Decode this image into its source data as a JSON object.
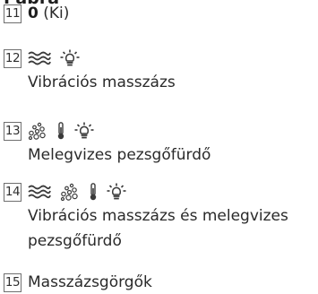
{
  "heading": "Pábra",
  "items": [
    {
      "number": "11",
      "label_bold": "0",
      "label_rest": "(Ki)"
    },
    {
      "number": "12",
      "icons": [
        "wave-icon",
        "heater-icon"
      ],
      "description": "Vibrációs masszázs"
    },
    {
      "number": "13",
      "icons": [
        "bubbles-icon",
        "thermometer-icon",
        "heater-icon"
      ],
      "description": "Melegvizes pezsgőfürdő"
    },
    {
      "number": "14",
      "icons": [
        "wave-icon",
        "bubbles-icon",
        "thermometer-icon",
        "heater-icon"
      ],
      "description_line1": "Vibrációs masszázs és melegvizes",
      "description_line2": "pezsgőfürdő"
    },
    {
      "number": "15",
      "label": "Masszázsgörgők"
    }
  ],
  "colors": {
    "text": "#2a2a2a",
    "box_border": "#6f6f6f"
  }
}
